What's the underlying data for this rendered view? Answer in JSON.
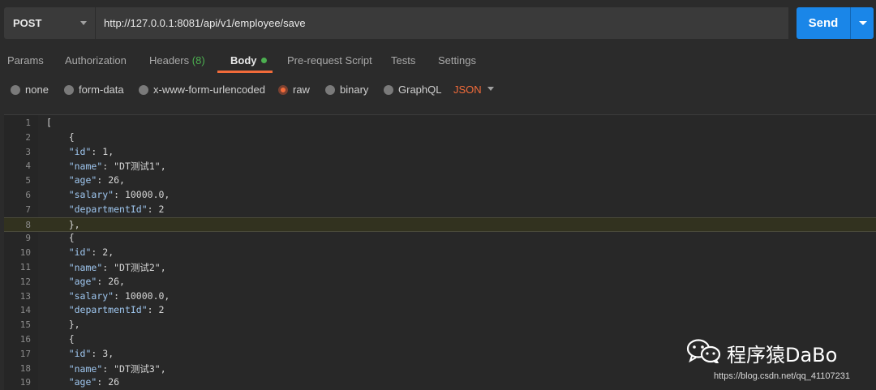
{
  "request": {
    "method": "POST",
    "url": "http://127.0.0.1:8081/api/v1/employee/save",
    "send_label": "Send"
  },
  "tabs": [
    {
      "label": "Params"
    },
    {
      "label": "Authorization"
    },
    {
      "label": "Headers",
      "count": "(8)"
    },
    {
      "label": "Body",
      "active": true
    },
    {
      "label": "Pre-request Script"
    },
    {
      "label": "Tests"
    },
    {
      "label": "Settings"
    }
  ],
  "body_options": {
    "items": [
      "none",
      "form-data",
      "x-www-form-urlencoded",
      "raw",
      "binary",
      "GraphQL"
    ],
    "selected": "raw",
    "format": "JSON"
  },
  "editor": {
    "lines": [
      {
        "n": "1",
        "text": "["
      },
      {
        "n": "2",
        "text": "    {"
      },
      {
        "n": "3",
        "text": "    \"id\": 1,"
      },
      {
        "n": "4",
        "text": "    \"name\": \"DT测试1\","
      },
      {
        "n": "5",
        "text": "    \"age\": 26,"
      },
      {
        "n": "6",
        "text": "    \"salary\": 10000.0,"
      },
      {
        "n": "7",
        "text": "    \"departmentId\": 2"
      },
      {
        "n": "8",
        "text": "    },"
      },
      {
        "n": "9",
        "text": "    {"
      },
      {
        "n": "10",
        "text": "    \"id\": 2,"
      },
      {
        "n": "11",
        "text": "    \"name\": \"DT测试2\","
      },
      {
        "n": "12",
        "text": "    \"age\": 26,"
      },
      {
        "n": "13",
        "text": "    \"salary\": 10000.0,"
      },
      {
        "n": "14",
        "text": "    \"departmentId\": 2"
      },
      {
        "n": "15",
        "text": "    },"
      },
      {
        "n": "16",
        "text": "    {"
      },
      {
        "n": "17",
        "text": "    \"id\": 3,"
      },
      {
        "n": "18",
        "text": "    \"name\": \"DT测试3\","
      },
      {
        "n": "19",
        "text": "    \"age\": 26"
      }
    ],
    "highlighted_line": "8"
  },
  "watermark": {
    "title": "程序猿DaBo",
    "url": "https://blog.csdn.net/qq_41107231"
  },
  "colors": {
    "accent": "#f26b3a",
    "send": "#1a86e8",
    "success": "#4caf50"
  }
}
